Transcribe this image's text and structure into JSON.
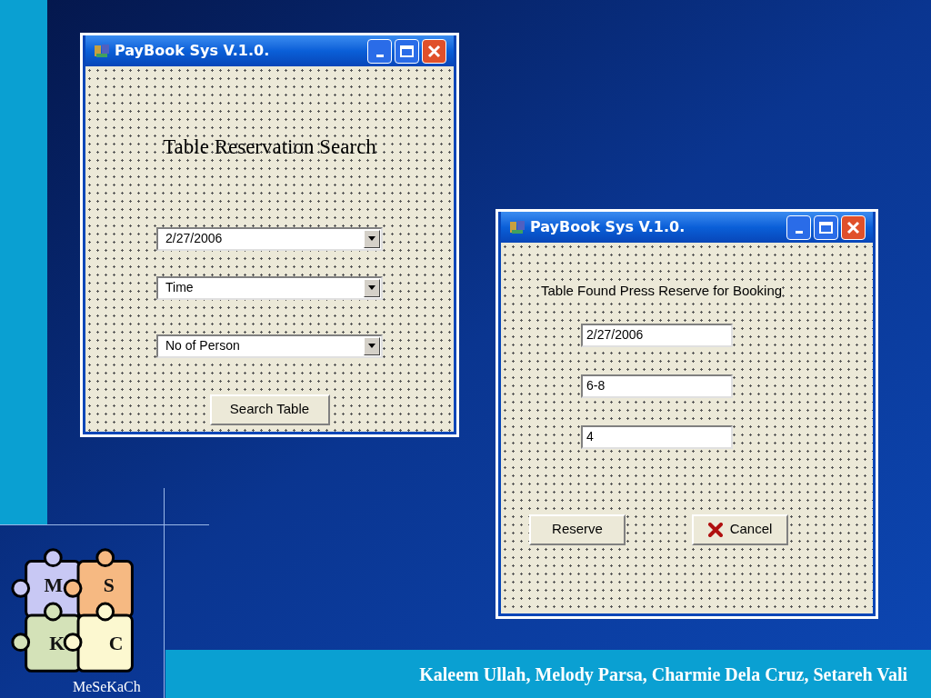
{
  "windows": [
    {
      "title": "PayBook Sys V.1.0.",
      "heading": {
        "kind": "heading",
        "text": "Table Reservation Search"
      },
      "fields": [
        {
          "kind": "dropdown",
          "value": "2/27/2006"
        },
        {
          "kind": "dropdown",
          "value": "Time"
        },
        {
          "kind": "dropdown",
          "value": "No of Person"
        }
      ],
      "buttons": [
        {
          "kind": "plain",
          "label": "Search Table"
        }
      ]
    },
    {
      "title": "PayBook Sys V.1.0.",
      "heading": {
        "kind": "label",
        "text": "Table Found Press Reserve for Booking"
      },
      "fields": [
        {
          "kind": "text",
          "value": "2/27/2006"
        },
        {
          "kind": "text",
          "value": "6-8"
        },
        {
          "kind": "text",
          "value": "4"
        }
      ],
      "buttons": [
        {
          "kind": "plain",
          "label": "Reserve"
        },
        {
          "kind": "cancel",
          "label": "Cancel"
        }
      ]
    }
  ],
  "logo": {
    "letters": [
      "M",
      "S",
      "K",
      "C"
    ],
    "name": "MeSeKaCh"
  },
  "footer": "Kaleem Ullah, Melody Parsa, Charmie Dela Cruz, Setareh Vali"
}
